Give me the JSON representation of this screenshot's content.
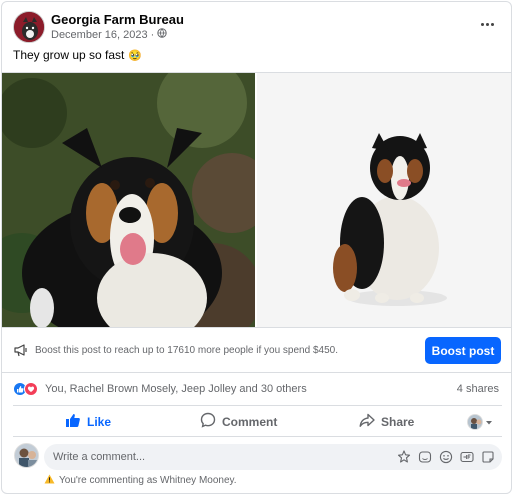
{
  "post": {
    "page_name": "Georgia Farm Bureau",
    "date": "December 16, 2023",
    "separator": "·",
    "audience_icon": "globe-icon",
    "text": "They grow up so fast",
    "emoji": "🥹"
  },
  "boost": {
    "text": "Boost this post to reach up to 17610 more people if you spend $450.",
    "button_label": "Boost post"
  },
  "reactions": {
    "icons": [
      "like-reaction-icon",
      "love-reaction-icon"
    ],
    "names": "You, Rachel Brown Mosely, Jeep Jolley and 30 others",
    "shares": "4 shares"
  },
  "actions": {
    "like": "Like",
    "comment": "Comment",
    "share": "Share"
  },
  "composer": {
    "placeholder": "Write a comment...",
    "tools": [
      "avatar-sticker-icon",
      "sticker-icon",
      "emoji-icon",
      "gif-icon",
      "camera-icon"
    ]
  },
  "commenting_as": {
    "icon": "warning-icon",
    "text": "You're commenting as Whitney Mooney."
  },
  "colors": {
    "accent": "#0866ff",
    "muted_text": "#65676b",
    "like": "#1877f2",
    "love": "#f33e58"
  }
}
